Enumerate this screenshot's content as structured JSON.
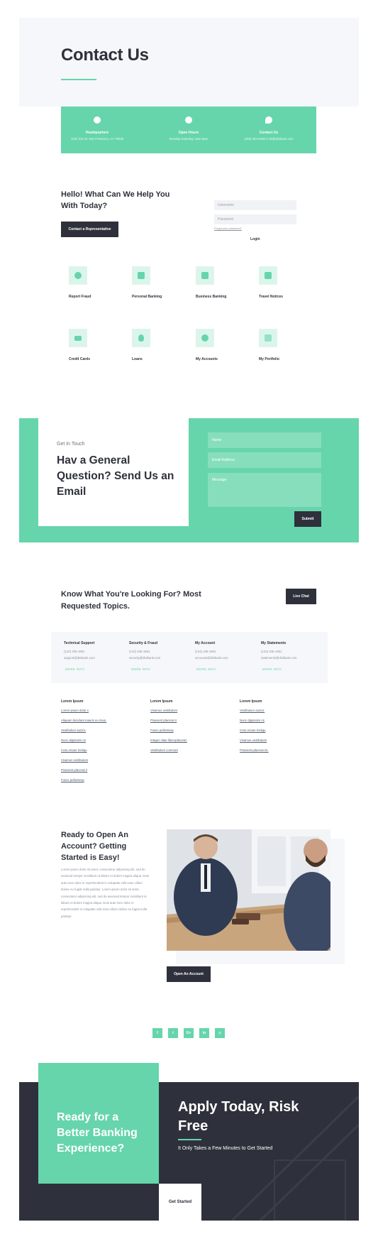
{
  "hero": {
    "title": "Contact Us"
  },
  "info_bar": [
    {
      "icon": "map-pin-icon",
      "title": "Headquarters",
      "sub": "1234 Divi St. San Francisco, CA 78236"
    },
    {
      "icon": "clock-icon",
      "title": "Open Hours",
      "sub": "Monday-Saturday: 8am-5pm"
    },
    {
      "icon": "chat-icon",
      "title": "Contact Us",
      "sub": "(255) 352-6258  |  info@divibank.com"
    }
  ],
  "hello": {
    "heading": "Hello! What Can We Help You With Today?",
    "contact_button": "Contact a Representative"
  },
  "login": {
    "username_placeholder": "Username",
    "password_placeholder": "Password",
    "forgot": "Forgot your password?",
    "login_label": "Login"
  },
  "services": [
    {
      "icon": "info-icon",
      "label": "Report Fraud"
    },
    {
      "icon": "wallet-icon",
      "label": "Personal Banking"
    },
    {
      "icon": "briefcase-icon",
      "label": "Business Banking"
    },
    {
      "icon": "suitcase-icon",
      "label": "Travel Notices"
    },
    {
      "icon": "credit-card-icon",
      "label": "Credit Cards"
    },
    {
      "icon": "money-bag-icon",
      "label": "Loans"
    },
    {
      "icon": "pie-chart-icon",
      "label": "My Accounts"
    },
    {
      "icon": "bar-chart-icon",
      "label": "My Portfolio"
    }
  ],
  "question": {
    "eyebrow": "Get In Touch",
    "heading": "Hav a General Question? Send Us an Email",
    "name_placeholder": "Name",
    "email_placeholder": "Email Address",
    "message_placeholder": "Message",
    "submit": "Submit"
  },
  "topics": {
    "heading": "Know What You're Looking For? Most Requested Topics.",
    "live_chat": "Live Chat",
    "cards": [
      {
        "title": "Technical Support",
        "phone": "(124) 235-1951",
        "email": "support@divibank.com",
        "more": "MORE INFO"
      },
      {
        "title": "Security & Fraud",
        "phone": "(124) 235-1951",
        "email": "security@divibank.com",
        "more": "MORE INFO"
      },
      {
        "title": "My Account",
        "phone": "(124) 235-1951",
        "email": "accounts@divibank.com",
        "more": "MORE INFO"
      },
      {
        "title": "My Statements",
        "phone": "(124) 235-1951",
        "email": "statements@divibank.com",
        "more": "MORE INFO"
      }
    ],
    "link_columns": [
      {
        "title": "Lorem Ipsum",
        "links": [
          "Lorem ipsum dolor s",
          "Aliquam tincidunt mauris eu risus.",
          "Vestibulum auctor.",
          "Nunc dignissim ris",
          "Cras ornare tristiqu",
          "Vivamus vestibulum",
          "Praesent placerat ri",
          "Fusce pellentesq"
        ]
      },
      {
        "title": "Lorem Ipsum",
        "links": [
          "Vivamus vestibulum",
          "Praesent placerat ri",
          "Fusce pellentesq",
          "Integer vitae liberoplacerat.",
          "Vestibulum commod"
        ]
      },
      {
        "title": "Lorem Ipsum",
        "links": [
          "Vestibulum auctor.",
          "Nunc dignissim ris",
          "Cras ornare tristiqu",
          "Vivamus vestibulum",
          "Praesent placerat ris."
        ]
      }
    ]
  },
  "ready": {
    "heading": "Ready to Open An Account? Getting Started is Easy!",
    "body": "Lorem ipsum dolor sit amet, consectetur adipiscing elit, sed do eiusmod tempor incididunt ut labore et dolore magna aliqua. Duis aute irure dolor in reprehenderit in voluptate velit esse cillum dolore eu fugiat nulla pariatur. Lorem ipsum dolor sit amet, consectetur adipiscing elit, sed do eiusmod tempor incididunt ut labore et dolore magna aliqua. Duis aute irure dolor in reprehenderit in voluptate velit esse cillum dolore eu fugiat nulla pariatur.",
    "button": "Open An Account"
  },
  "social": [
    {
      "icon": "facebook-icon",
      "glyph": "f"
    },
    {
      "icon": "twitter-icon",
      "glyph": "t"
    },
    {
      "icon": "google-plus-icon",
      "glyph": "G+"
    },
    {
      "icon": "linkedin-icon",
      "glyph": "in"
    },
    {
      "icon": "instagram-icon",
      "glyph": "◎"
    }
  ],
  "cta": {
    "left_text": "Ready for a Better Banking Experience?",
    "heading": "Apply Today, Risk Free",
    "sub": "It Only Takes a Few Minutes to Get Started",
    "button": "Get Started"
  },
  "colors": {
    "accent": "#66d5ab",
    "dark": "#2e313b",
    "light_band": "#f6f7fa"
  }
}
